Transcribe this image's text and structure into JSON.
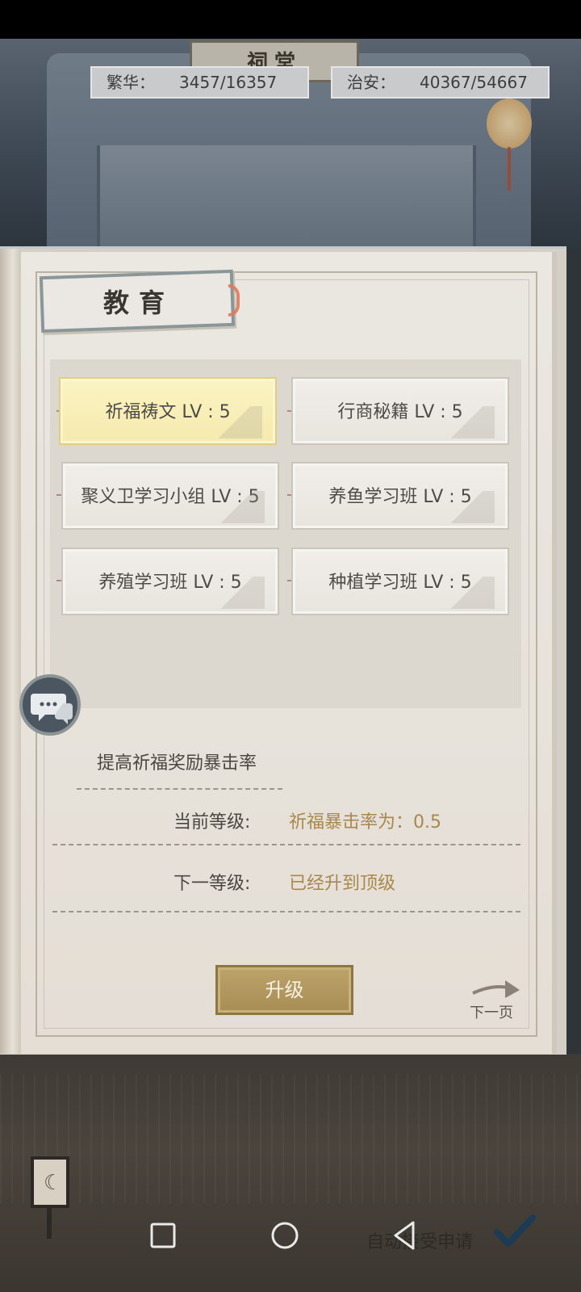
{
  "header": {
    "hall_sign": "祠堂",
    "prosperity": {
      "label": "繁华：",
      "value": "3457/16357"
    },
    "security": {
      "label": "治安：",
      "value": "40367/54667"
    }
  },
  "panel": {
    "title": "教育",
    "skills": [
      {
        "name": "祈福祷文 LV : 5",
        "selected": true
      },
      {
        "name": "行商秘籍 LV : 5",
        "selected": false
      },
      {
        "name": "聚义卫学习小组 LV : 5",
        "selected": false
      },
      {
        "name": "养鱼学习班 LV : 5",
        "selected": false
      },
      {
        "name": "养殖学习班 LV : 5",
        "selected": false
      },
      {
        "name": "种植学习班 LV : 5",
        "selected": false
      }
    ],
    "description": "提高祈福奖励暴击率",
    "current_level": {
      "label": "当前等级:",
      "value": "祈福暴击率为：0.5"
    },
    "next_level": {
      "label": "下一等级:",
      "value": "已经升到顶级"
    },
    "upgrade_label": "升级",
    "next_page_label": "下一页"
  },
  "footer": {
    "auto_accept_label": "自动接受申请"
  },
  "colors": {
    "accent_gold": "#a8884c",
    "selected_card": "#fbf3c2",
    "button_gold": "#bca36a"
  }
}
